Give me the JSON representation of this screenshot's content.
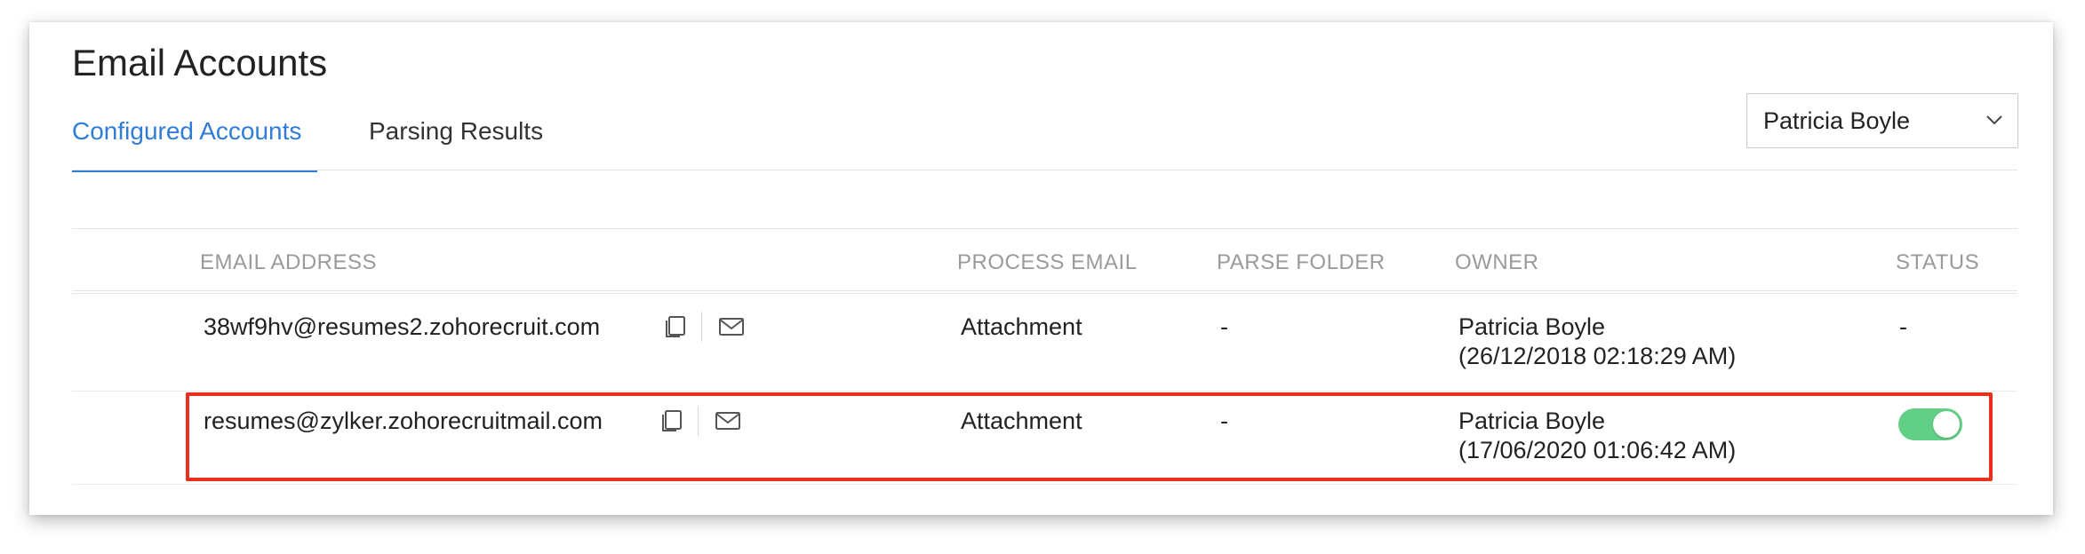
{
  "page": {
    "title": "Email Accounts"
  },
  "tabs": [
    {
      "label": "Configured Accounts",
      "active": true
    },
    {
      "label": "Parsing Results",
      "active": false
    }
  ],
  "owner_filter": {
    "selected": "Patricia Boyle"
  },
  "table": {
    "columns": [
      "EMAIL ADDRESS",
      "PROCESS EMAIL",
      "PARSE FOLDER",
      "OWNER",
      "STATUS"
    ],
    "rows": [
      {
        "email": "38wf9hv@resumes2.zohorecruit.com",
        "process_email": "Attachment",
        "parse_folder": "-",
        "owner_name": "Patricia Boyle",
        "owner_date": "(26/12/2018 02:18:29 AM)",
        "status": "-",
        "status_toggle": null
      },
      {
        "email": "resumes@zylker.zohorecruitmail.com",
        "process_email": "Attachment",
        "parse_folder": "-",
        "owner_name": "Patricia Boyle",
        "owner_date": "(17/06/2020 01:06:42 AM)",
        "status": "",
        "status_toggle": true
      }
    ]
  },
  "icons": {
    "copy": "copy-icon",
    "mail": "mail-icon",
    "chevron": "chevron-down-icon"
  },
  "colors": {
    "accent": "#2f7dd6",
    "highlight": "#e8301d",
    "toggle_on": "#62cf86",
    "header_text": "#9a9a9a"
  }
}
